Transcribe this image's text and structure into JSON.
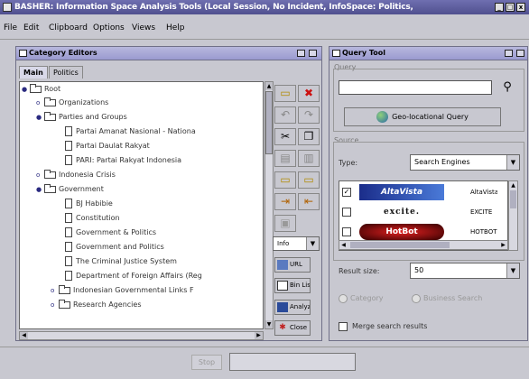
{
  "window": {
    "title": "BASHER: Information Space Analysis Tools (Local Session, No Incident, InfoSpace: Politics,",
    "controls": [
      "_",
      "□",
      "x"
    ]
  },
  "menubar": [
    "File",
    "Edit",
    "Clipboard",
    "Options",
    "Views",
    "Help"
  ],
  "category_editors": {
    "title": "Category Editors",
    "tabs": [
      "Main",
      "Politics"
    ],
    "tree": [
      {
        "label": "Root",
        "type": "folder",
        "expanded": true
      },
      {
        "label": "Organizations",
        "type": "folder",
        "expanded": false
      },
      {
        "label": "Parties and Groups",
        "type": "folder",
        "expanded": true
      },
      {
        "label": "Partai Amanat Nasional - Nationa",
        "type": "doc"
      },
      {
        "label": "Partai Daulat Rakyat",
        "type": "doc"
      },
      {
        "label": "PARI: Partai Rakyat Indonesia",
        "type": "doc"
      },
      {
        "label": "Indonesia Crisis",
        "type": "folder",
        "expanded": false
      },
      {
        "label": "Government",
        "type": "folder",
        "expanded": true
      },
      {
        "label": "BJ Habibie",
        "type": "doc"
      },
      {
        "label": "Constitution",
        "type": "doc"
      },
      {
        "label": "Government & Politics",
        "type": "doc"
      },
      {
        "label": "Government and Politics",
        "type": "doc"
      },
      {
        "label": "The Criminal Justice System",
        "type": "doc"
      },
      {
        "label": "Department of Foreign Affairs (Reg",
        "type": "doc"
      },
      {
        "label": "Indonesian Governmental Links F",
        "type": "folder",
        "expanded": false
      },
      {
        "label": "Research Agencies",
        "type": "folder",
        "expanded": false
      }
    ],
    "toolbar": {
      "icons": [
        "new-folder-icon",
        "delete-icon",
        "undo-icon",
        "redo-icon",
        "cut-icon",
        "copy-icon",
        "paste-icon",
        "paste-into-icon",
        "open-folder-icon",
        "folder-icon",
        "import-icon",
        "export-icon",
        "properties-icon"
      ],
      "select_value": "Info",
      "buttons": [
        "URL",
        "Bin List",
        "Analyze",
        "Close"
      ]
    }
  },
  "query_tool": {
    "title": "Query Tool",
    "query_label": "Query",
    "query_value": "",
    "geo_button": "Geo-locational Query",
    "source_label": "Source",
    "type_label": "Type:",
    "type_value": "Search Engines",
    "engines": [
      {
        "logo": "AltaVista",
        "name": "AltaVista",
        "checked": true
      },
      {
        "logo": "excite.",
        "name": "EXCITE",
        "checked": false
      },
      {
        "logo": "HotBot",
        "name": "HOTBOT",
        "checked": false
      }
    ],
    "result_size_label": "Result size:",
    "result_size_value": "50",
    "radio_category": "Category",
    "radio_business": "Business Search",
    "merge_label": "Merge search results"
  },
  "statusbar": {
    "stop_label": "Stop",
    "status_text": ""
  },
  "colors": {
    "title_bar": "#5a5a9a",
    "frame_title": "#a8a8d8",
    "background": "#c8c8d0"
  }
}
